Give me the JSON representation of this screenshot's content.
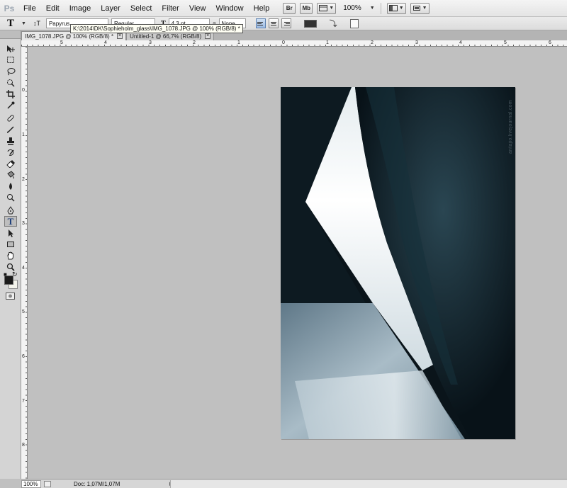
{
  "app": {
    "logo": "Ps",
    "menu": [
      "File",
      "Edit",
      "Image",
      "Layer",
      "Select",
      "Filter",
      "View",
      "Window",
      "Help"
    ],
    "bar_buttons": [
      "Br",
      "Mb"
    ],
    "zoom": "100%"
  },
  "options": {
    "tool_glyph": "T",
    "orient_glyph": "↕T",
    "font_family": "Papyrus",
    "font_style": "Regular",
    "font_size": "4.3 pt",
    "aa_label": "a",
    "antialias": "None",
    "text_color": "#333333"
  },
  "tooltip": "K:\\2014\\DK\\Sophieholm_glass\\IMG_1078.JPG @ 100% (RGB/8) *",
  "tabs": [
    {
      "label": "IMG_1078.JPG @ 100% (RGB/8) *",
      "close": "×"
    },
    {
      "label": "Untitled-1 @ 66,7% (RGB/8)",
      "close": "×"
    }
  ],
  "rulers": {
    "h_labels": [
      "5",
      "4",
      "3",
      "2",
      "1",
      "0",
      "1",
      "2",
      "3",
      "4",
      "5",
      "6"
    ],
    "v_labels": [
      "0",
      "1",
      "2",
      "3",
      "4",
      "5",
      "6",
      "7",
      "8"
    ]
  },
  "document": {
    "watermark": "antajio.livejournal.com",
    "colors": {
      "dark": "#081218",
      "shadow": "#1d3440",
      "highlight": "#f4f8fa",
      "floor": "#8ea5b2"
    }
  },
  "status": {
    "zoom": "100%",
    "doc": "Doc: 1,07M/1,07M",
    "arrow": "▶"
  }
}
